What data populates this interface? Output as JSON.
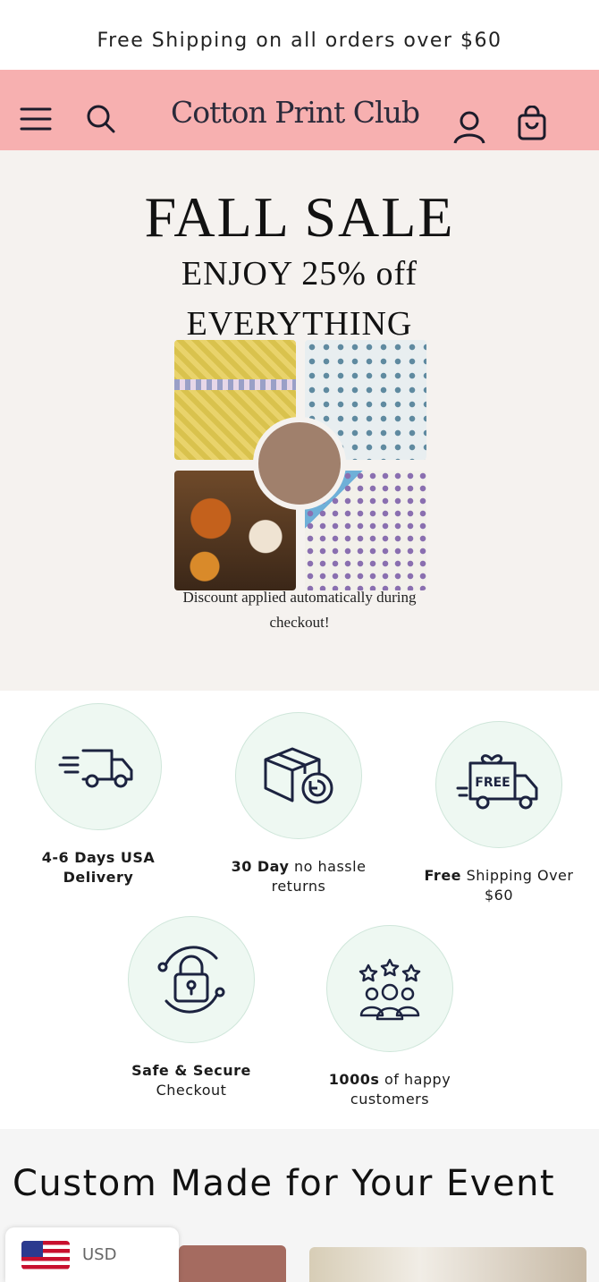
{
  "announcement": "Free Shipping on all orders over $60",
  "header": {
    "logo": "Cotton Print Club",
    "icons": [
      "menu-icon",
      "search-icon",
      "account-icon",
      "cart-icon"
    ]
  },
  "hero": {
    "title": "FALL SALE",
    "subtitle_line1": "ENJOY 25% off",
    "subtitle_line2": "EVERYTHING",
    "discount_note": "Discount applied automatically during checkout!"
  },
  "features": [
    {
      "bold": "4-6 Days USA Delivery",
      "rest": "",
      "icon": "truck-icon"
    },
    {
      "bold": "30 Day",
      "rest": " no hassle returns",
      "icon": "return-box-icon"
    },
    {
      "bold": "Free",
      "rest": " Shipping Over $60",
      "icon": "free-shipping-truck-icon"
    },
    {
      "bold": "Safe & Secure",
      "rest": " Checkout",
      "icon": "lock-icon"
    },
    {
      "bold": "1000s",
      "rest": " of happy customers",
      "icon": "happy-customers-icon"
    }
  ],
  "custom_section": {
    "title": "Custom Made for Your Event"
  },
  "currency": {
    "code": "USD"
  },
  "colors": {
    "header_bg": "#f7b0b0",
    "hero_bg": "#f5f2ef",
    "feature_circle": "#eef8f2"
  }
}
